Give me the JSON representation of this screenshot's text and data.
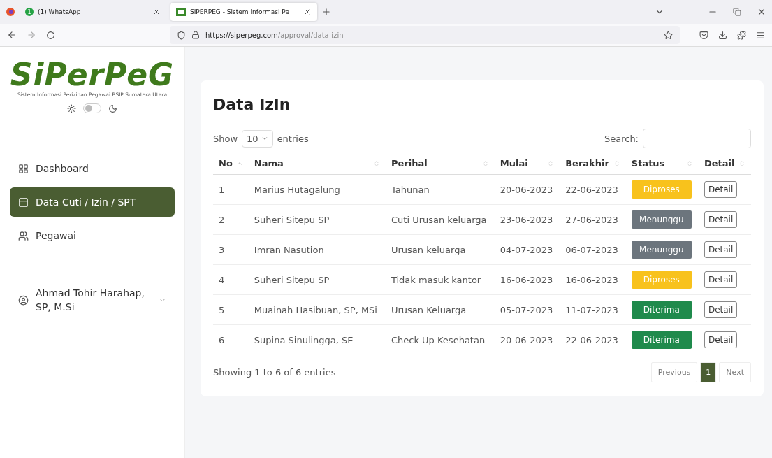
{
  "browser": {
    "tabs": [
      {
        "title": "(1) WhatsApp",
        "badge": "1",
        "selected": false
      },
      {
        "title": "SIPERPEG - Sistem Informasi Pe",
        "selected": true
      }
    ],
    "url_host": "https://siperpeg.com",
    "url_path": "/approval/data-izin"
  },
  "sidebar": {
    "logo": "SiPerPeG",
    "tagline": "Sistem Informasi Perizinan Pegawai BSIP Sumatera Utara",
    "dark_mode": false,
    "items": [
      {
        "label": "Dashboard",
        "selected": false
      },
      {
        "label": "Data Cuti / Izin / SPT",
        "selected": true
      },
      {
        "label": "Pegawai",
        "selected": false
      }
    ],
    "user": "Ahmad Tohir Harahap, SP, M.Si"
  },
  "main": {
    "title": "Data Izin",
    "show_label": "Show",
    "page_size": "10",
    "entries_label": "entries",
    "search_label": "Search:",
    "table": {
      "columns": [
        "No",
        "Nama",
        "Perihal",
        "Mulai",
        "Berakhir",
        "Status",
        "Detail"
      ],
      "rows": [
        {
          "no": "1",
          "nama": "Marius Hutagalung",
          "perihal": "Tahunan",
          "mulai": "20-06-2023",
          "berakhir": "22-06-2023",
          "status": "Diproses",
          "kind": "processing",
          "detail": "Detail"
        },
        {
          "no": "2",
          "nama": "Suheri Sitepu SP",
          "perihal": "Cuti Urusan keluarga",
          "mulai": "23-06-2023",
          "berakhir": "27-06-2023",
          "status": "Menunggu",
          "kind": "waiting",
          "detail": "Detail"
        },
        {
          "no": "3",
          "nama": "Imran Nasution",
          "perihal": "Urusan keluarga",
          "mulai": "04-07-2023",
          "berakhir": "06-07-2023",
          "status": "Menunggu",
          "kind": "waiting",
          "detail": "Detail"
        },
        {
          "no": "4",
          "nama": "Suheri Sitepu SP",
          "perihal": "Tidak masuk kantor",
          "mulai": "16-06-2023",
          "berakhir": "16-06-2023",
          "status": "Diproses",
          "kind": "processing",
          "detail": "Detail"
        },
        {
          "no": "5",
          "nama": "Muainah Hasibuan, SP, MSi",
          "perihal": "Urusan Keluarga",
          "mulai": "05-07-2023",
          "berakhir": "11-07-2023",
          "status": "Diterima",
          "kind": "accepted",
          "detail": "Detail"
        },
        {
          "no": "6",
          "nama": "Supina Sinulingga, SE",
          "perihal": "Check Up Kesehatan",
          "mulai": "20-06-2023",
          "berakhir": "22-06-2023",
          "status": "Diterima",
          "kind": "accepted",
          "detail": "Detail"
        }
      ]
    },
    "info": "Showing 1 to 6 of 6 entries",
    "pagination": [
      {
        "label": "Previous",
        "kind": "nav",
        "selected": false
      },
      {
        "label": "1",
        "kind": "page",
        "selected": true
      },
      {
        "label": "Next",
        "kind": "nav",
        "selected": false
      }
    ]
  }
}
